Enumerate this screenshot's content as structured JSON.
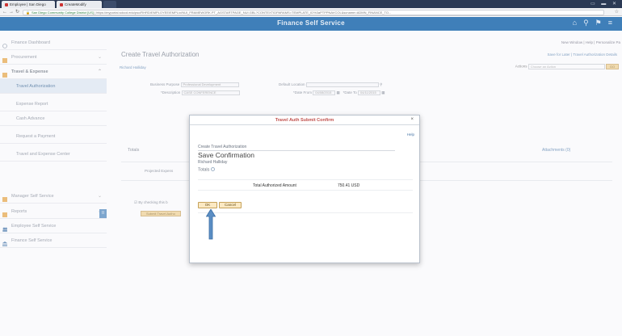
{
  "browser": {
    "tabs": [
      {
        "label": "Employee | San Diego",
        "color": "#c33"
      },
      {
        "label": "CreateModify",
        "color": "#c33"
      }
    ],
    "url_ssl": "San Diego Community College District [US]",
    "url_path": "https://myportal.sdccd.edu/psc/RHRD/EMPLOYEE/EMPL/c/NUI_FRAMEWORK.PT_AGSTARTPAGE_NUI.GBL?CONTEXTIDPARAMS=TEMPLATE_ID%3aPTPPNAVCOL&scname=ADMN_FINANCE_TO..."
  },
  "app": {
    "title": "Finance Self Service",
    "header_icons": [
      "home-icon",
      "search-icon",
      "flag-icon",
      "menu-icon"
    ]
  },
  "sidebar": {
    "items": [
      {
        "label": "Finance Dashboard",
        "icon": "dashboard-icon"
      },
      {
        "label": "Procurement",
        "icon": "cart-icon"
      },
      {
        "label": "Travel & Expense",
        "icon": "briefcase-icon"
      },
      {
        "label": "Travel Authorization",
        "icon": ""
      },
      {
        "label": "Expense Report",
        "icon": ""
      },
      {
        "label": "Cash Advance",
        "icon": ""
      },
      {
        "label": "Request a Payment",
        "icon": ""
      },
      {
        "label": "Travel and Expense Center",
        "icon": ""
      },
      {
        "label": "Manager Self Service",
        "icon": "folder-icon"
      },
      {
        "label": "Reports",
        "icon": "report-icon"
      },
      {
        "label": "Employee Self Service",
        "icon": "people-icon"
      },
      {
        "label": "Finance Self Service",
        "icon": "bank-icon"
      }
    ],
    "collapse_label": "II"
  },
  "main": {
    "new_window": "New Window | Help | Personalize Pa",
    "page_title": "Create Travel Authorization",
    "save_later": "Save for Later | Travel Authorization Details",
    "user_name": "Richard Halliday",
    "actions_label": "Actions",
    "actions_select": "Choose an Action",
    "go_label": "GO",
    "business_purpose_label": "Business Purpose",
    "business_purpose_value": "Professional Development",
    "description_label": "*Description",
    "description_value": "CASE CONFERENCE",
    "default_location_label": "Default Location",
    "date_from_label": "*Date From",
    "date_from_value": "04/08/2015",
    "date_to_label": "*Date To",
    "date_to_value": "04/11/2015",
    "totals_label": "Totals",
    "attachments_label": "Attachments (0)",
    "projected_label": "Projected Expens",
    "certify_label": "By checking this b",
    "submit_label": "Submit Travel Autho"
  },
  "modal": {
    "title": "Travel Auth Submit Confirm",
    "help": "Help",
    "breadcrumb": "Create Travel Authorization",
    "heading": "Save Confirmation",
    "user": "Richard Halliday",
    "totals": "Totals",
    "amount_label": "Total Authorized Amount",
    "amount_value": "750.41  USD",
    "ok_label": "OK",
    "cancel_label": "Cancel"
  },
  "colors": {
    "header": "#3f7fb9",
    "modal_title": "#c0504d",
    "arrow": "#3a6ea5"
  }
}
